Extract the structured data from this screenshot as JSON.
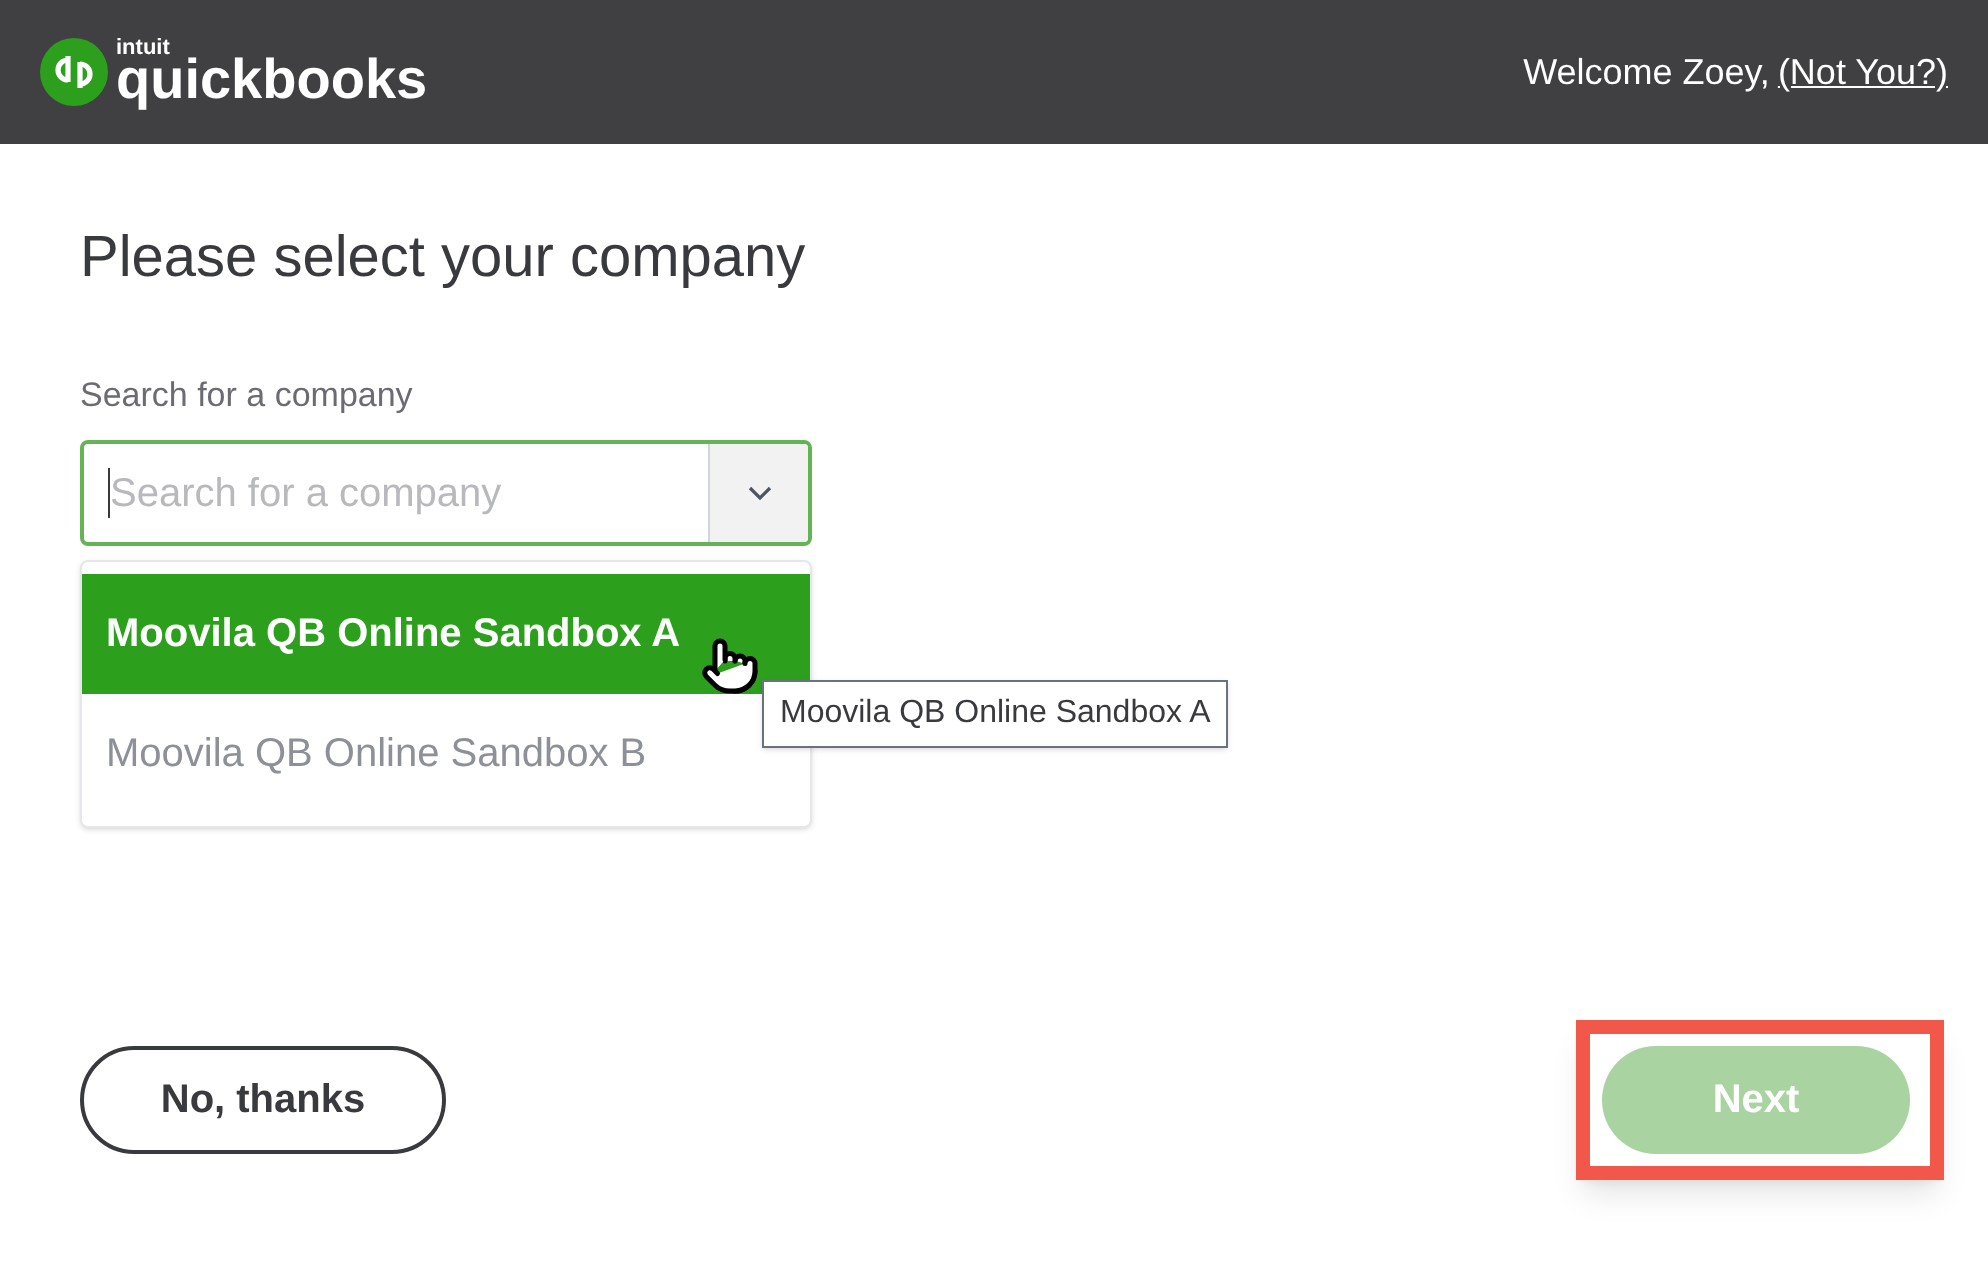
{
  "header": {
    "logo_small": "intuit",
    "logo": "quickbooks",
    "welcome": "Welcome Zoey,",
    "not_you_link": "(Not You?)"
  },
  "title": "Please select your company",
  "search": {
    "label": "Search for a company",
    "placeholder": "Search for a company"
  },
  "companies": [
    {
      "name": "Moovila QB Online Sandbox A",
      "selected": true
    },
    {
      "name": "Moovila QB Online Sandbox B",
      "selected": false
    }
  ],
  "tooltip": "Moovila QB Online Sandbox A",
  "buttons": [
    {
      "label": "No, thanks",
      "kind": "secondary",
      "disabled": false,
      "highlighted": false
    },
    {
      "label": "Next",
      "kind": "primary",
      "disabled": true,
      "highlighted": true
    }
  ]
}
